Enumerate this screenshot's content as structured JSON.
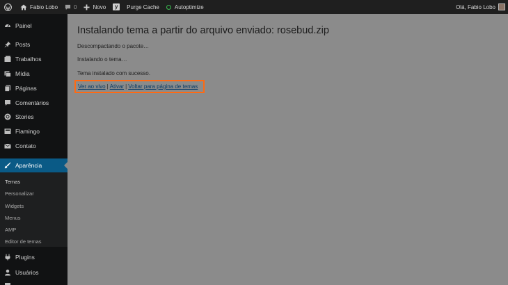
{
  "admin_bar": {
    "site_name": "Fabio Lobo",
    "comments_count": "0",
    "new_label": "Novo",
    "purge_cache_label": "Purge Cache",
    "autoptimize_label": "Autoptimize",
    "greeting": "Olá, Fabio Lobo",
    "icons": {
      "wp": "wordpress-logo-icon",
      "home": "home-icon",
      "comments": "comment-bubble-icon",
      "new": "plus-icon",
      "yoast": "yoast-icon",
      "autoptimize": "status-circle-icon"
    },
    "colors": {
      "status": "#3bbf52"
    }
  },
  "sidebar": {
    "items": [
      {
        "label": "Painel",
        "icon": "dashboard-icon"
      },
      {
        "label": "Posts",
        "icon": "pin-icon"
      },
      {
        "label": "Trabalhos",
        "icon": "folders-icon"
      },
      {
        "label": "Mídia",
        "icon": "media-icon"
      },
      {
        "label": "Páginas",
        "icon": "pages-icon"
      },
      {
        "label": "Comentários",
        "icon": "comments-icon"
      },
      {
        "label": "Stories",
        "icon": "stories-icon"
      },
      {
        "label": "Flamingo",
        "icon": "flamingo-icon"
      },
      {
        "label": "Contato",
        "icon": "mail-icon"
      },
      {
        "label": "Aparência",
        "icon": "brush-icon",
        "active": true
      },
      {
        "label": "Plugins",
        "icon": "plugin-icon"
      },
      {
        "label": "Usuários",
        "icon": "users-icon"
      }
    ],
    "submenu": [
      "Temas",
      "Personalizar",
      "Widgets",
      "Menus",
      "AMP",
      "Editor de temas"
    ],
    "colors": {
      "active": "#0a5a86",
      "background": "#111213"
    }
  },
  "main": {
    "title": "Instalando tema a partir do arquivo enviado: rosebud.zip",
    "steps": [
      "Descompactando o pacote…",
      "Instalando o tema…",
      "Tema instalado com sucesso."
    ],
    "links": {
      "preview": "Ver ao vivo",
      "activate": "Ativar",
      "back": "Voltar para página de temas",
      "separator": "|"
    },
    "colors": {
      "highlight": "#ff6a13",
      "link": "#0a3d68"
    }
  }
}
